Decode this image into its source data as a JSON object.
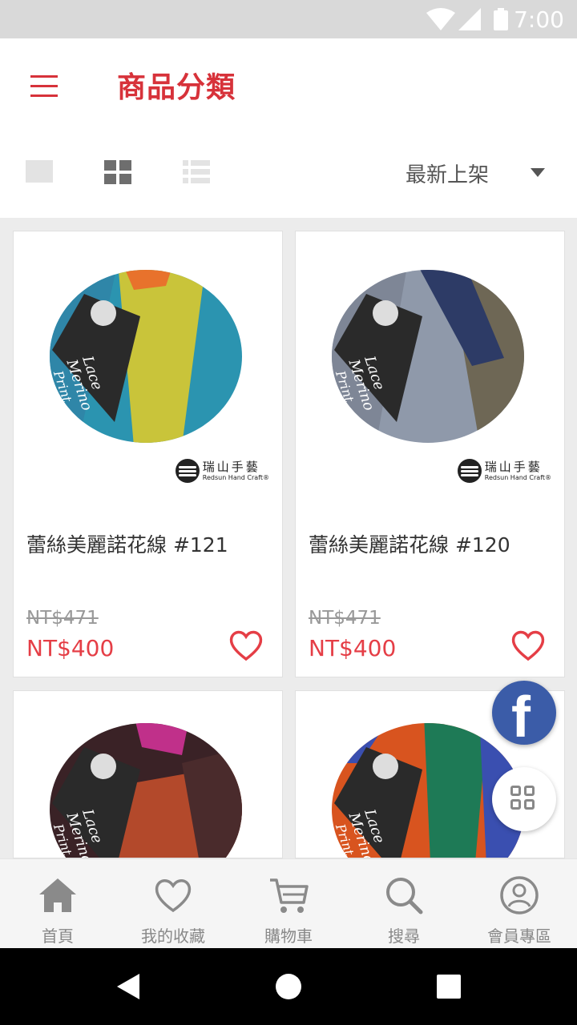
{
  "status_bar": {
    "time": "7:00"
  },
  "header": {
    "title": "商品分類",
    "sort_label": "最新上架"
  },
  "brand": {
    "name_zh": "瑞山手藝",
    "name_en": "Redsun Hand Craft®"
  },
  "yarn_label": {
    "line1": "Lace",
    "line2": "Merino",
    "line3": "Print"
  },
  "products": [
    {
      "name": "蕾絲美麗諾花線 #121",
      "old_price": "NT$471",
      "price": "NT$400"
    },
    {
      "name": "蕾絲美麗諾花線 #120",
      "old_price": "NT$471",
      "price": "NT$400"
    }
  ],
  "floating": {
    "facebook_letter": "f"
  },
  "bottom_nav": [
    {
      "label": "首頁",
      "icon": "home-icon"
    },
    {
      "label": "我的收藏",
      "icon": "heart-icon"
    },
    {
      "label": "購物車",
      "icon": "cart-icon"
    },
    {
      "label": "搜尋",
      "icon": "search-icon"
    },
    {
      "label": "會員專區",
      "icon": "user-icon"
    }
  ],
  "colors": {
    "accent": "#d7323a",
    "price": "#e53e46",
    "facebook": "#3b5ca8",
    "yarn_121": [
      "#2b94b0",
      "#c9c43a",
      "#e8722c"
    ],
    "yarn_120": [
      "#8f99aa",
      "#6e6755",
      "#2d3b66"
    ],
    "yarn_119": [
      "#3a2226",
      "#b3492b",
      "#c0308a"
    ],
    "yarn_118": [
      "#d8541f",
      "#1e7a56",
      "#3a4fb0"
    ]
  }
}
